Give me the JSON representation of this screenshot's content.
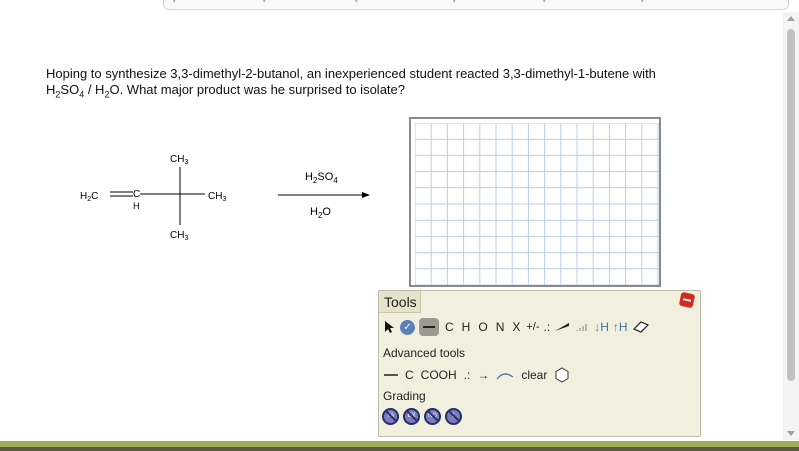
{
  "question": {
    "line1": "Hoping to synthesize 3,3-dimethyl-2-butanol, an inexperienced student reacted 3,3-dimethyl-1-butene with",
    "h": "H",
    "sub2a": "2",
    "so": "SO",
    "sub4": "4",
    "slash_h": " / H",
    "sub2b": "2",
    "rest": "O. What major product was he surprised to isolate?"
  },
  "reaction": {
    "ch3_top": "CH",
    "ch3_top_sub": "3",
    "ch3_right": "CH",
    "ch3_right_sub": "3",
    "ch3_bottom": "CH",
    "ch3_bottom_sub": "3",
    "h2c": "H",
    "h2c_sub": "2",
    "h2c_c": "C",
    "c": "C",
    "h": "H",
    "reagent_top_h": "H",
    "reagent_top_sub2": "2",
    "reagent_top_so": "SO",
    "reagent_top_sub4": "4",
    "reagent_bottom_h": "H",
    "reagent_bottom_sub2": "2",
    "reagent_bottom_o": "O"
  },
  "tools": {
    "tab_label": "Tools",
    "atoms": [
      "C",
      "H",
      "O",
      "N",
      "X"
    ],
    "charge_label": "+/-",
    "lone_pair_label": ".:",
    "down_h": "↓H",
    "up_h": "↑H",
    "advanced_label": "Advanced tools",
    "adv_c": "C",
    "adv_cooh": "COOH",
    "adv_dots": ".:",
    "adv_arrow": "→",
    "clear_label": "clear",
    "grading_label": "Grading",
    "grading_icons": [
      "TA",
      "EX",
      "NG",
      "1"
    ]
  },
  "colors": {
    "grid_line": "#b9cfe6",
    "panel_bg": "#f1f0de",
    "accent_green": "#9caf56"
  }
}
